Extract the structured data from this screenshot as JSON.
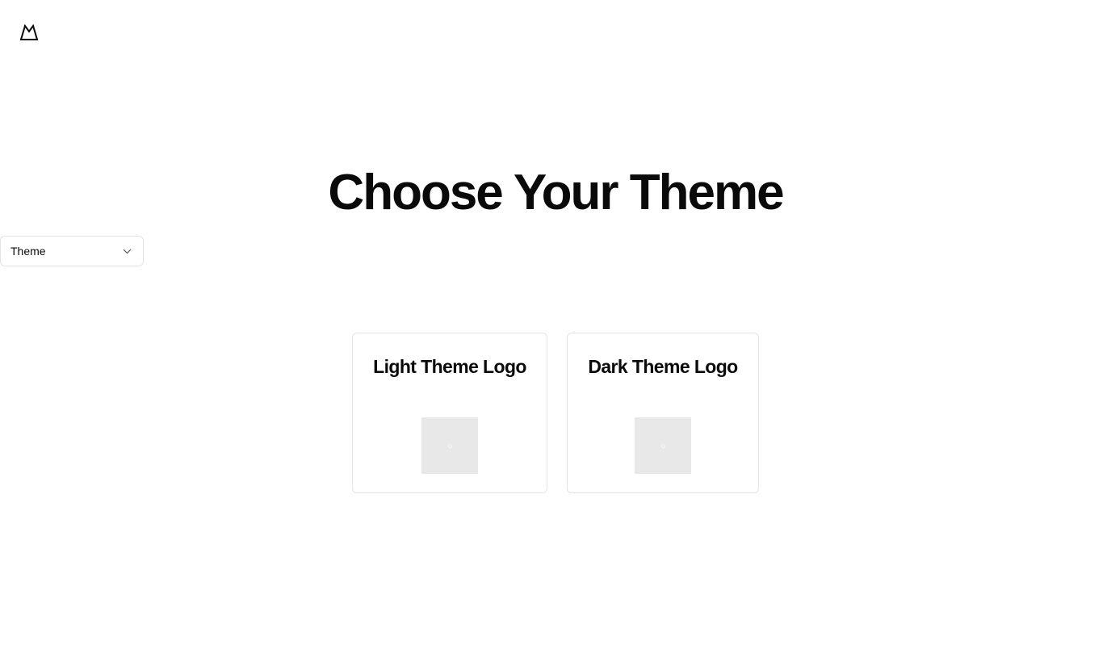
{
  "header": {
    "logo_icon": "mountain-icon"
  },
  "main": {
    "title": "Choose Your Theme"
  },
  "theme_select": {
    "selected": "Theme",
    "icon": "chevron-down-icon"
  },
  "cards": [
    {
      "title": "Light Theme Logo",
      "image_icon": "image-placeholder-icon"
    },
    {
      "title": "Dark Theme Logo",
      "image_icon": "image-placeholder-icon"
    }
  ],
  "colors": {
    "text": "#0a0a0a",
    "border": "#e4e4e7",
    "placeholder_bg": "#e8e8e8"
  }
}
